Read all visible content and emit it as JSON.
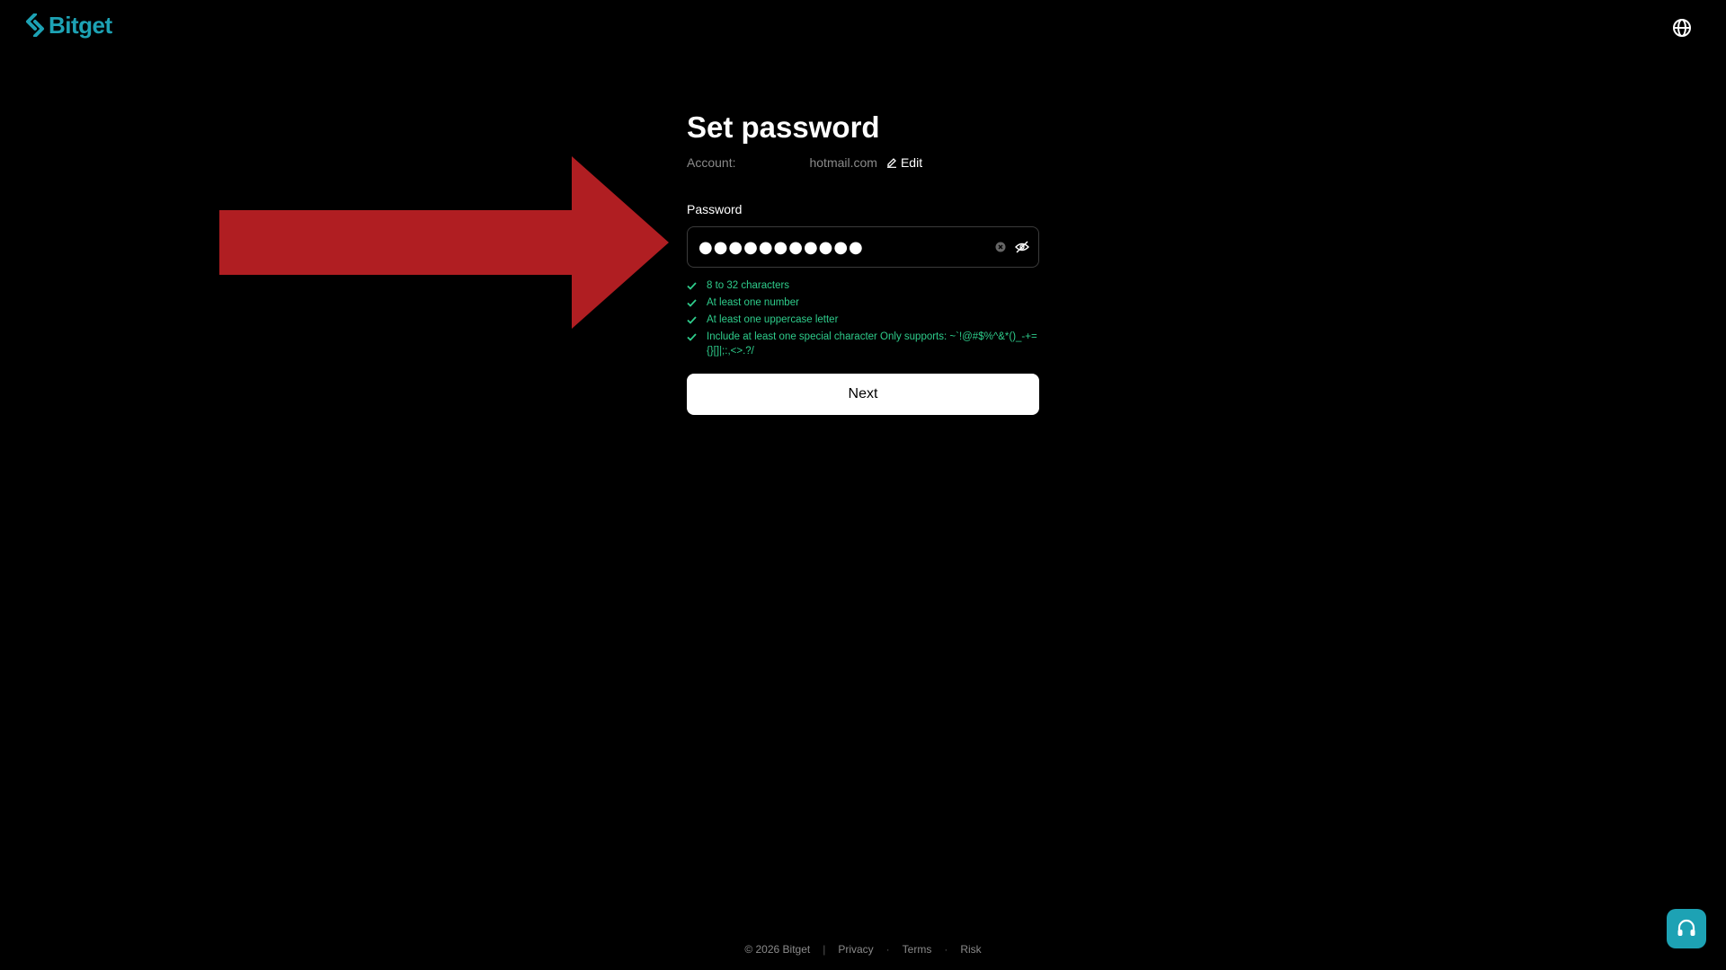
{
  "header": {
    "brand": "Bitget",
    "brand_color": "#1DA2B4",
    "language_icon": "globe-icon"
  },
  "form": {
    "title": "Set password",
    "account_label": "Account:",
    "account_value": "hotmail.com",
    "edit_label": "Edit",
    "password_label": "Password",
    "password_value": "●●●●●●●●●●●",
    "clear_icon": "clear-icon",
    "visibility_icon": "eye-off-icon",
    "rules": [
      {
        "text": "8 to 32 characters",
        "met": true
      },
      {
        "text": "At least one number",
        "met": true
      },
      {
        "text": "At least one uppercase letter",
        "met": true
      },
      {
        "text": "Include at least one special character Only supports: ~`!@#$%^&*()_-+={}[]|;:,<>.?/",
        "met": true
      }
    ],
    "rule_color": "#2ECC8B",
    "next_label": "Next"
  },
  "overlay": {
    "arrow_color": "#B01E22"
  },
  "footer": {
    "copyright": "© 2026 Bitget",
    "privacy": "Privacy",
    "terms": "Terms",
    "risk": "Risk"
  },
  "support": {
    "icon": "headset-icon"
  }
}
